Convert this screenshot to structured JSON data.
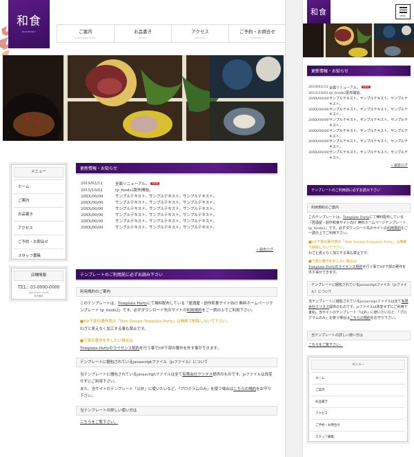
{
  "logo": {
    "kanji": "和食",
    "subtitle": "WASHOKU"
  },
  "nav": [
    {
      "jp": "ご案内",
      "en": "INFORMATION"
    },
    {
      "jp": "お品書き",
      "en": "MENU"
    },
    {
      "jp": "アクセス",
      "en": "ACCESS"
    },
    {
      "jp": "ご予約・お問合せ",
      "en": "CONTACT"
    }
  ],
  "menu_button_label": "MENU",
  "sidebar": {
    "menu_title": "メニュー",
    "items": [
      "ホーム",
      "ご案内",
      "お品書き",
      "アクセス",
      "ご予約・お問合せ",
      "スタッフ募集"
    ],
    "shop_title": "店舗情報",
    "tel": "TEL：03-0000-0000",
    "hours": "AM 10:00〜23:00\n年中無休"
  },
  "news": {
    "title": "更新情報・お知らせ",
    "items": [
      {
        "date": "2019/02/12",
        "text": "全面リニューアル。",
        "badge": "NEW"
      },
      {
        "date": "2015/10/02",
        "text": "tp_foods2配布開始。"
      },
      {
        "date": "20XX/00/00",
        "text": "サンプルテキスト。サンプルテキスト。サンプルテキスト。"
      },
      {
        "date": "20XX/00/00",
        "text": "サンプルテキスト。サンプルテキスト。サンプルテキスト。"
      },
      {
        "date": "20XX/00/00",
        "text": "サンプルテキスト。サンプルテキスト。サンプルテキスト。"
      },
      {
        "date": "20XX/00/00",
        "text": "サンプルテキスト。サンプルテキスト。サンプルテキスト。"
      },
      {
        "date": "20XX/00/00",
        "text": "サンプルテキスト。サンプルテキスト。サンプルテキスト。"
      },
      {
        "date": "20XX/00/00",
        "text": "サンプルテキスト。サンプルテキスト。サンプルテキスト。"
      }
    ],
    "more": "» 過去ログ"
  },
  "template": {
    "title": "テンプレートのご利用前に必ずお読み下さい",
    "h_usage": "利用規約のご案内",
    "p1_a": "このテンプレートは、",
    "p1_link1": "Template Party",
    "p1_b": "にて無料配布している「居酒屋・創作和食サイト向け 無料ホームページテンプレート tp_foods2」です。必ずダウンロード先のサイトの",
    "p1_link2": "利用規約",
    "p1_c": "をご一読の上でご利用下さい。",
    "warn1": "■HP下部の著作表示「Web Design:Template-Party」は無断で削除しないで下さい。",
    "p2": "わざと見えなく加工する事も禁止です。",
    "warn2": "■下部の著作を外したい場合は",
    "p3_link": "Template-Partyのライセンス契約",
    "p3_rest": "を行う事でHP下部の著作を外す事ができます。",
    "h_js": "テンプレートに梱包されているjavascriptファイル（jsファイル）について",
    "p4_a": "当テンプレートに梱包されているjavascriptファイルは全て",
    "p4_link": "有限会社クリタス",
    "p4_b": "提供のものです。jsファイルは改変せずにご利用下さい。",
    "p5_a": "また、当サイトのテンプレート「以外」に使いたいなど、「プログラムのみ」を使う場合は",
    "p5_link": "こちらの規約",
    "p5_b": "をお守り下さい。",
    "h_detail": "当テンプレートの詳しい使い方は",
    "detail_link": "こちらをご覧下さい。"
  }
}
